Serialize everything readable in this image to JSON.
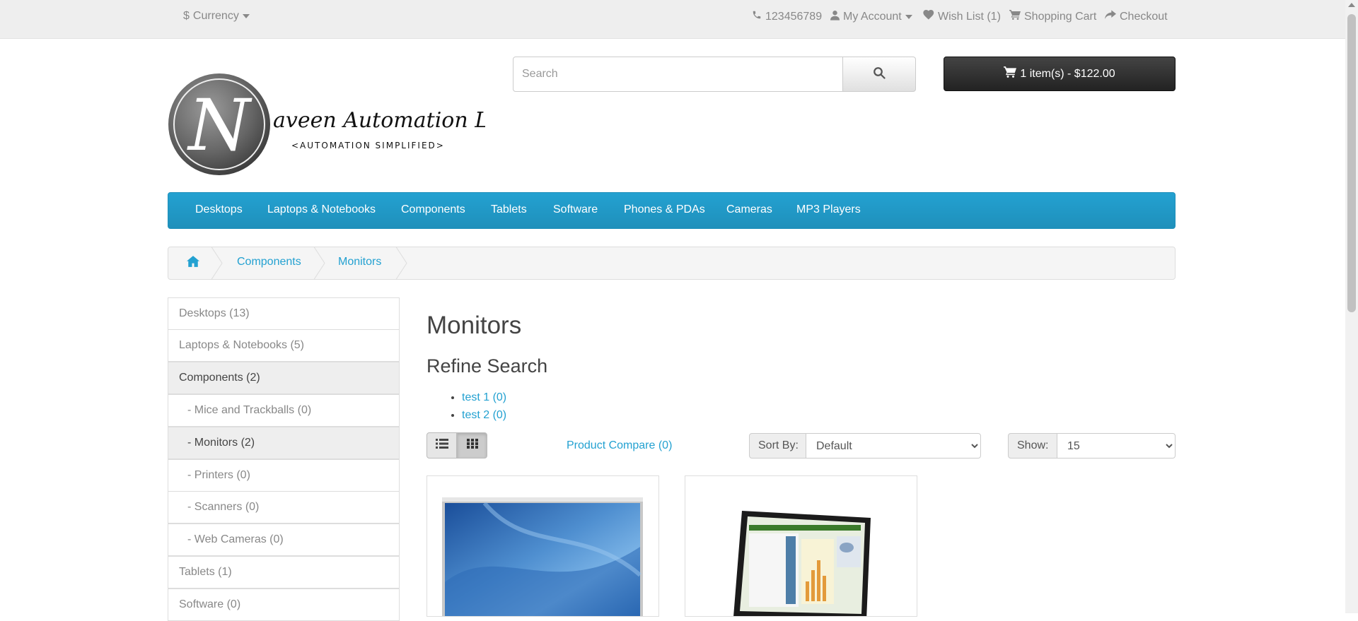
{
  "topbar": {
    "currency_label": "Currency",
    "currency_symbol": "$",
    "phone": "123456789",
    "my_account": "My Account",
    "wishlist": "Wish List (1)",
    "shopping_cart": "Shopping Cart",
    "checkout": "Checkout"
  },
  "logo": {
    "initial": "N",
    "name": "aveen Automation Labs",
    "tagline": "<AUTOMATION SIMPLIFIED>"
  },
  "search": {
    "placeholder": "Search",
    "value": ""
  },
  "cart": {
    "label": "1 item(s) - $122.00"
  },
  "menu": {
    "items": [
      {
        "label": "Desktops"
      },
      {
        "label": "Laptops & Notebooks"
      },
      {
        "label": "Components"
      },
      {
        "label": "Tablets"
      },
      {
        "label": "Software"
      },
      {
        "label": "Phones & PDAs"
      },
      {
        "label": "Cameras"
      },
      {
        "label": "MP3 Players"
      }
    ]
  },
  "breadcrumb": {
    "items": [
      {
        "label": "Components"
      },
      {
        "label": "Monitors"
      }
    ]
  },
  "sidebar": {
    "items": [
      {
        "label": "Desktops (13)"
      },
      {
        "label": "Laptops & Notebooks (5)"
      },
      {
        "label": "Components (2)"
      },
      {
        "label": "- Mice and Trackballs (0)"
      },
      {
        "label": "- Monitors (2)"
      },
      {
        "label": "- Printers (0)"
      },
      {
        "label": "- Scanners (0)"
      },
      {
        "label": "- Web Cameras (0)"
      },
      {
        "label": "Tablets (1)"
      },
      {
        "label": "Software (0)"
      }
    ]
  },
  "main": {
    "title": "Monitors",
    "refine_title": "Refine Search",
    "refine_items": [
      {
        "label": "test 1 (0)"
      },
      {
        "label": "test 2 (0)"
      }
    ],
    "compare_label": "Product Compare (0)",
    "sort": {
      "label": "Sort By:",
      "value": "Default"
    },
    "show": {
      "label": "Show:",
      "value": "15"
    }
  },
  "colors": {
    "accent": "#23a1d1",
    "topbar_bg": "#eeeeee",
    "cart_bg": "#222222"
  }
}
